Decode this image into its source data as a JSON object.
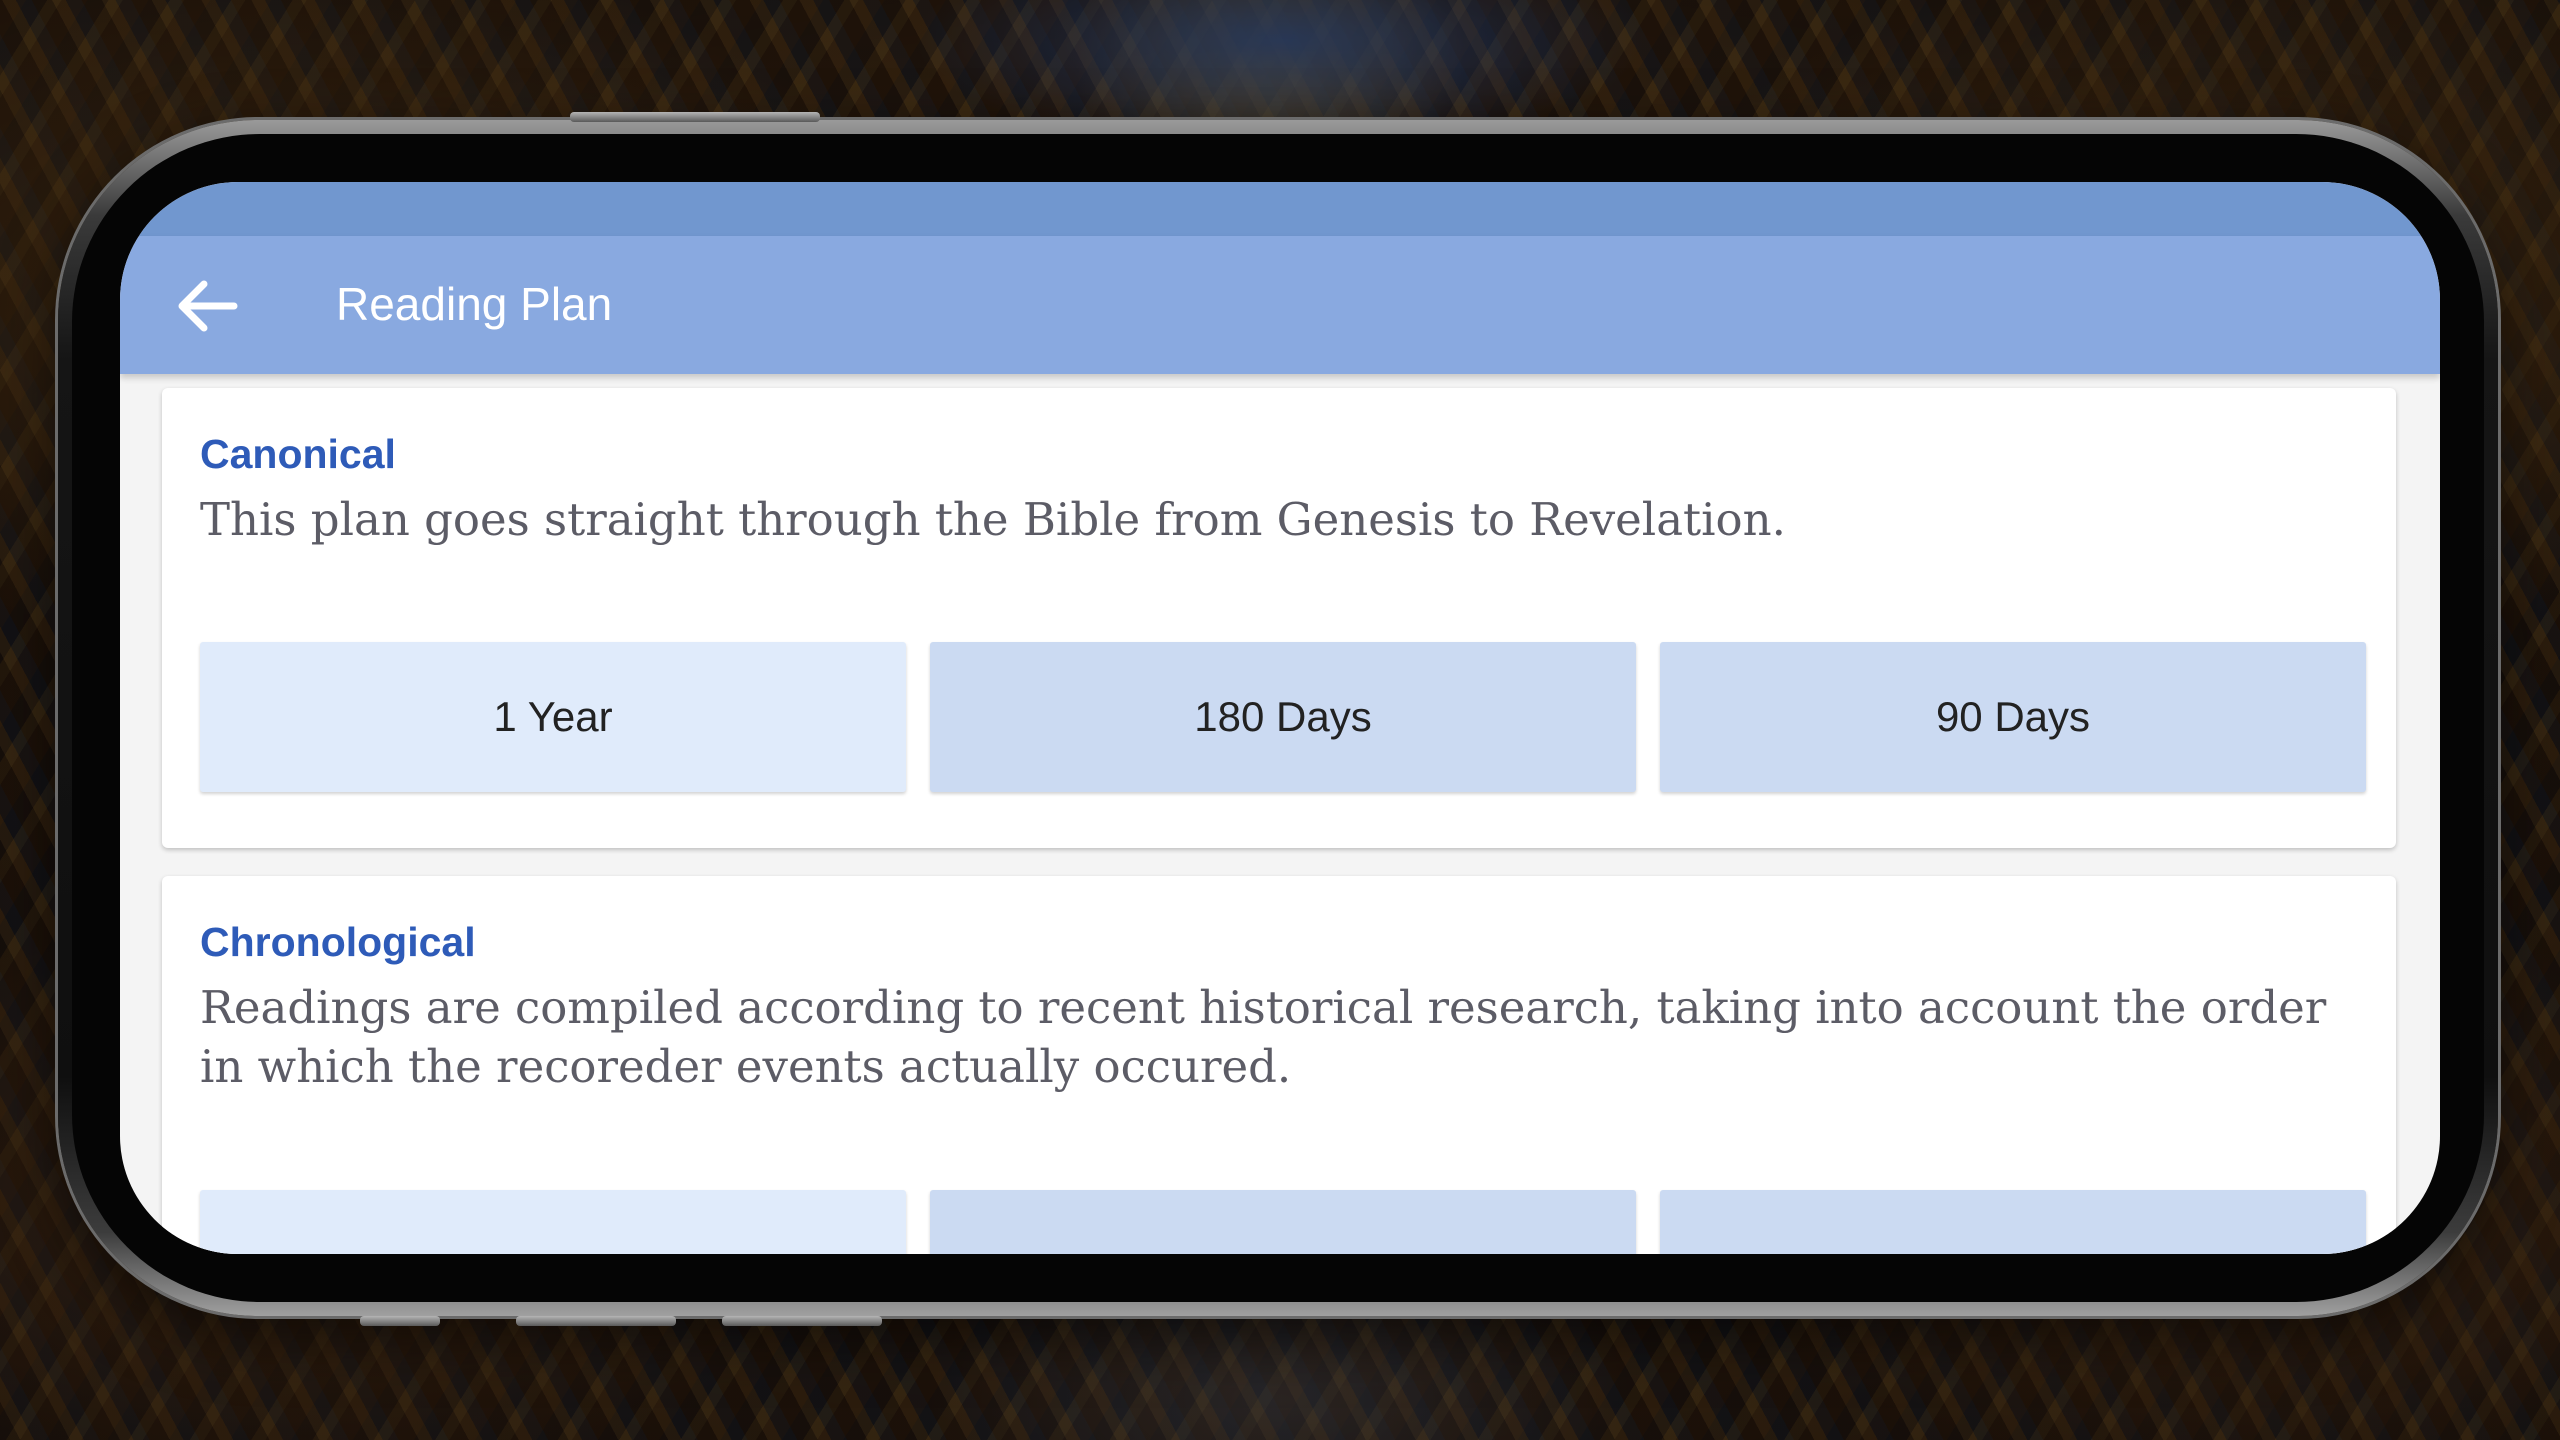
{
  "app_bar": {
    "title": "Reading Plan",
    "back_icon": "arrow-back-icon"
  },
  "plans": [
    {
      "title": "Canonical",
      "description": "This plan goes straight through the Bible from Genesis to Revelation.",
      "options": [
        "1 Year",
        "180 Days",
        "90 Days"
      ]
    },
    {
      "title": "Chronological",
      "description": "Readings are compiled according to recent historical research, taking into account the order in which the recoreder events actually occured."
    }
  ],
  "colors": {
    "status_strip": "#7197cf",
    "app_bar": "#89a9e0",
    "card_title": "#2e5bb8",
    "button_light": "#e0ebfb",
    "button_medium": "#cbdaf2"
  }
}
